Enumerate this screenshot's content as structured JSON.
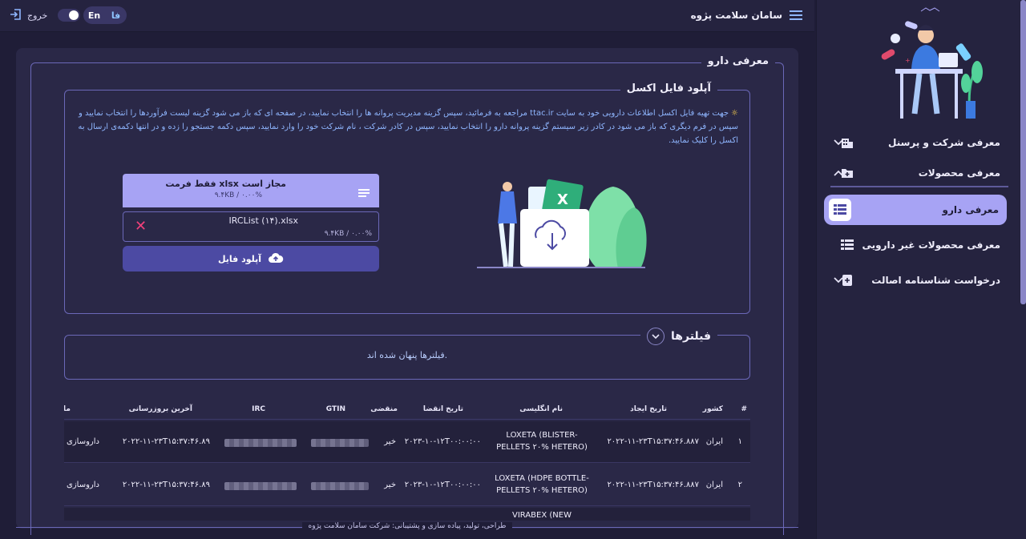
{
  "header": {
    "brand": "سامان سلامت پژوه",
    "logout": "خروج",
    "lang_en": "En",
    "lang_fa": "فا"
  },
  "sidebar": {
    "items": [
      {
        "label": "معرفی شرکت و پرسنل",
        "icon": "building-icon",
        "chevron": "down"
      },
      {
        "label": "معرفی محصولات",
        "icon": "folder-plus-icon",
        "chevron": "up"
      },
      {
        "label": "معرفی دارو",
        "icon": "table-list-icon",
        "active": true
      },
      {
        "label": "معرفی محصولات غیر دارویی",
        "icon": "table-list-icon"
      },
      {
        "label": "درخواست شناسنامه اصالت",
        "icon": "file-plus-icon",
        "chevron": "down"
      }
    ]
  },
  "page": {
    "title": "معرفی دارو",
    "upload_section": "آپلود فایل اکسل",
    "instructions": "جهت تهیه فایل اکسل اطلاعات دارویی خود به سایت ttac.ir مراجعه به فرمائید، سپس گزینه مدیریت پروانه ها را انتخاب نمایید، در صفحه ای که باز می شود گزینه لیست فرآوردها را انتخاب نمایید و سپس در فرم دیگری که باز می شود در کادر زیر سیستم گزینه پروانه دارو را انتخاب نمایید، سپس در کادر شرکت ، نام شرکت خود را وارد نمایید، سپس دکمه جستجو را زده و در انتها دکمه‌ی ارسال به اکسل را کلیک نمایید.",
    "upload_hint": "فقط فرمت xlsx مجاز است",
    "upload_hint_size": "۹.۴KB / ۰.۰۰%",
    "file_name": "IRCList (۱۴).xlsx",
    "file_size": "۹.۴KB / ۰.۰۰%",
    "upload_button": "آپلود فایل",
    "filters_title": "فیلترها",
    "filters_hidden": "فیلترها پنهان شده اند.",
    "footer": "طراحی، تولید، پیاده سازی و پشتیبانی: شرکت سامان سلامت پژوه"
  },
  "table": {
    "headers": [
      "#",
      "کشور",
      "تاریخ ایجاد",
      "نام انگلیسی",
      "تاریخ انقضا",
      "منقضی",
      "GTIN",
      "IRC",
      "آخرین بروزرسانی",
      "ما"
    ],
    "rows": [
      {
        "num": "۱",
        "country": "ایران",
        "created": "۲۰۲۲-۱۱-۲۳T۱۵:۳۷:۴۶.۸۸۷",
        "english_1": "LOXETA (BLISTER-",
        "english_2": "PELLETS ۲۰% HETERO)",
        "expiry": "۲۰۲۳-۱۰-۱۲T۰۰:۰۰:۰۰",
        "expired": "خیر",
        "updated": "۲۰۲۲-۱۱-۲۳T۱۵:۳۷:۴۶.۸۹",
        "cat": "داروسازی"
      },
      {
        "num": "۲",
        "country": "ایران",
        "created": "۲۰۲۲-۱۱-۲۳T۱۵:۳۷:۴۶.۸۸۷",
        "english_1": "LOXETA (HDPE BOTTLE-",
        "english_2": "PELLETS ۲۰% HETERO)",
        "expiry": "۲۰۲۳-۱۰-۱۲T۰۰:۰۰:۰۰",
        "expired": "خیر",
        "updated": "۲۰۲۲-۱۱-۲۳T۱۵:۳۷:۴۶.۸۹",
        "cat": "داروسازی"
      },
      {
        "num": "",
        "country": "",
        "created": "",
        "english_1": "VIRABEX (NEW",
        "english_2": "",
        "expiry": "",
        "expired": "",
        "updated": "",
        "cat": ""
      }
    ]
  },
  "colors": {
    "background": "#1f1d37",
    "panel": "#2a2847",
    "accent": "#a7a3f4",
    "button": "#4c4aa3",
    "danger": "#f0407a",
    "link_text": "#8fb6ff"
  }
}
